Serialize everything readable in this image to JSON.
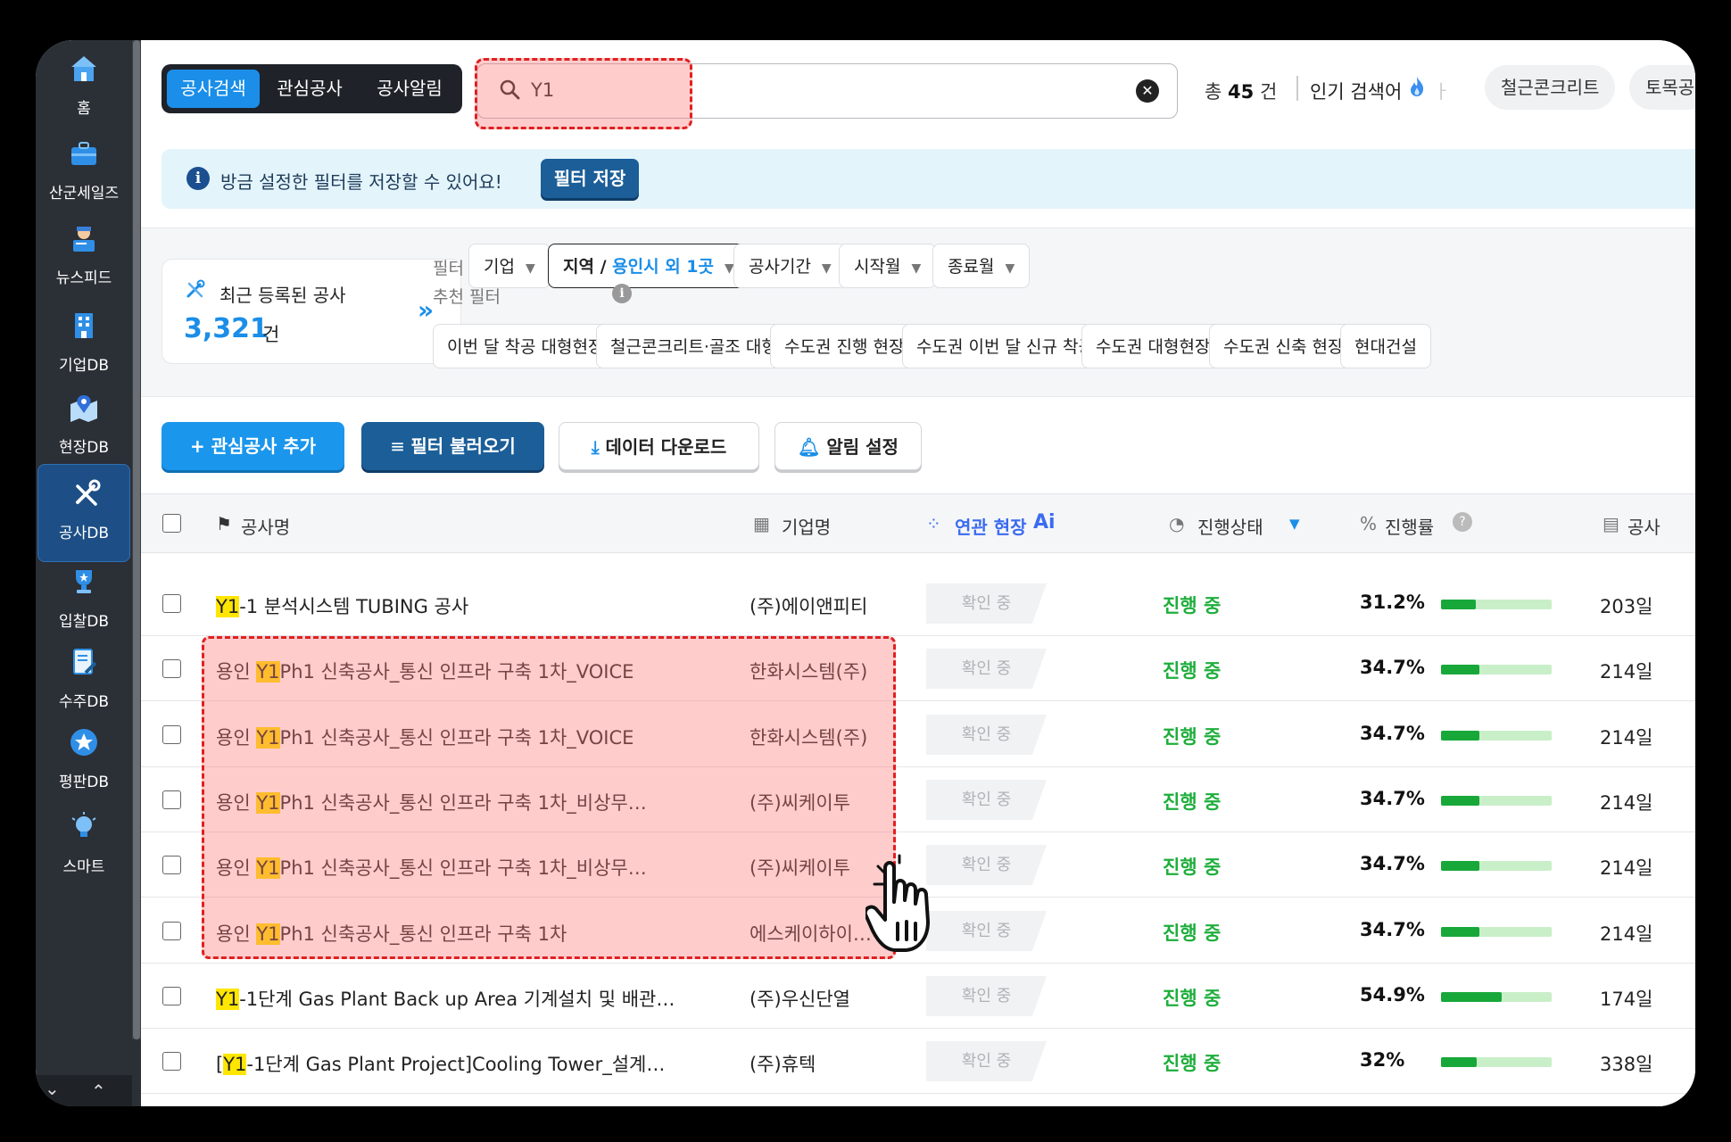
{
  "sidebar": {
    "items": [
      {
        "label": "홈",
        "icon": "home-icon"
      },
      {
        "label": "산군세일즈",
        "icon": "briefcase-icon"
      },
      {
        "label": "뉴스피드",
        "icon": "news-reader-icon"
      },
      {
        "label": "기업DB",
        "icon": "building-icon"
      },
      {
        "label": "현장DB",
        "icon": "map-pin-icon"
      },
      {
        "label": "공사DB",
        "icon": "tools-icon"
      },
      {
        "label": "입찰DB",
        "icon": "trophy-icon"
      },
      {
        "label": "수주DB",
        "icon": "document-pen-icon"
      },
      {
        "label": "평판DB",
        "icon": "star-badge-icon"
      },
      {
        "label": "스마트",
        "icon": "lightbulb-icon"
      }
    ],
    "active_index": 5
  },
  "topbar": {
    "tabs": [
      "공사검색",
      "관심공사",
      "공사알림"
    ],
    "search_value": "Y1",
    "total_prefix": "총",
    "total_count": "45",
    "total_suffix": "건",
    "popular_label": "인기 검색어",
    "popular_fade": "ㅏ",
    "chips": [
      "철근콘크리트",
      "토목공"
    ]
  },
  "banner": {
    "text": "방금 설정한 필터를 저장할 수 있어요!",
    "button": "필터 저장"
  },
  "recent": {
    "title": "최근 등록된 공사",
    "count": "3,321",
    "unit": "건"
  },
  "filters": {
    "label": "필터",
    "company": "기업",
    "region_label": "지역 /",
    "region_value": "용인시 외 1곳",
    "period": "공사기간",
    "start": "시작월",
    "end": "종료월",
    "recommend_label": "추천 필터",
    "recommend": [
      "이번 달 착공 대형현장",
      "철근콘크리트·골조 대형",
      "수도권 진행 현장",
      "수도권 이번 달 신규 착공",
      "수도권 대형현장",
      "수도권 신축 현장",
      "현대건설"
    ]
  },
  "actions": {
    "add": "+ 관심공사 추가",
    "load": "필터 불러오기",
    "download": "데이터 다운로드",
    "alert": "알림 설정"
  },
  "table": {
    "headers": {
      "name": "공사명",
      "company": "기업명",
      "related": "연관 현장",
      "related_ai": "Ai",
      "status": "진행상태",
      "progress": "진행률",
      "period": "공사"
    },
    "rows": [
      {
        "prefix": "",
        "hl": "Y1",
        "rest": "-1 분석시스템 TUBING 공사",
        "company": "(주)에이앤피티",
        "related": "확인 중",
        "status": "진행 중",
        "progress": "31.2%",
        "progress_value": 31.2,
        "days": "203일"
      },
      {
        "prefix": "용인 ",
        "hl": "Y1",
        "rest": "Ph1 신축공사_통신 인프라 구축 1차_VOICE",
        "company": "한화시스템(주)",
        "related": "확인 중",
        "status": "진행 중",
        "progress": "34.7%",
        "progress_value": 34.7,
        "days": "214일"
      },
      {
        "prefix": "용인 ",
        "hl": "Y1",
        "rest": "Ph1 신축공사_통신 인프라 구축 1차_VOICE",
        "company": "한화시스템(주)",
        "related": "확인 중",
        "status": "진행 중",
        "progress": "34.7%",
        "progress_value": 34.7,
        "days": "214일"
      },
      {
        "prefix": "용인 ",
        "hl": "Y1",
        "rest": "Ph1 신축공사_통신 인프라 구축 1차_비상무…",
        "company": "(주)씨케이투",
        "related": "확인 중",
        "status": "진행 중",
        "progress": "34.7%",
        "progress_value": 34.7,
        "days": "214일"
      },
      {
        "prefix": "용인 ",
        "hl": "Y1",
        "rest": "Ph1 신축공사_통신 인프라 구축 1차_비상무…",
        "company": "(주)씨케이투",
        "related": "확인 중",
        "status": "진행 중",
        "progress": "34.7%",
        "progress_value": 34.7,
        "days": "214일"
      },
      {
        "prefix": "용인 ",
        "hl": "Y1",
        "rest": "Ph1 신축공사_통신 인프라 구축 1차",
        "company": "에스케이하이…",
        "related": "확인 중",
        "status": "진행 중",
        "progress": "34.7%",
        "progress_value": 34.7,
        "days": "214일"
      },
      {
        "prefix": "",
        "hl": "Y1",
        "rest": "-1단계 Gas Plant Back up Area 기계설치 및 배관…",
        "company": "(주)우신단열",
        "related": "확인 중",
        "status": "진행 중",
        "progress": "54.9%",
        "progress_value": 54.9,
        "days": "174일"
      },
      {
        "prefix": "[",
        "hl": "Y1",
        "rest": "-1단계 Gas Plant Project]Cooling Tower_설계…",
        "company": "(주)휴텍",
        "related": "확인 중",
        "status": "진행 중",
        "progress": "32%",
        "progress_value": 32,
        "days": "338일"
      }
    ]
  },
  "colors": {
    "accent": "#1a8ee8",
    "status_green": "#1fae3c",
    "highlight": "#ffe600",
    "annotation_red": "#e02020"
  }
}
